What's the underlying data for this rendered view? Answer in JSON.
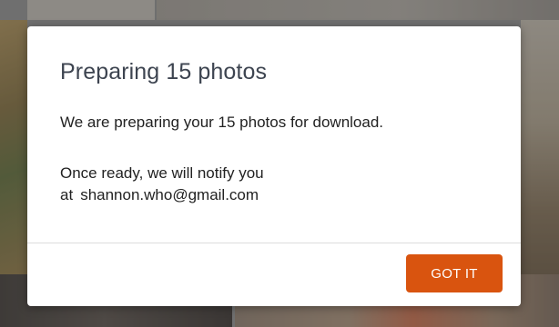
{
  "dialog": {
    "title": "Preparing 15 photos",
    "message": "We are preparing your 15 photos for download.",
    "notify_line": "Once ready, we will notify you",
    "notify_prefix": "at",
    "email": "shannon.who@gmail.com",
    "confirm_label": "GOT IT"
  },
  "colors": {
    "accent": "#d9540f",
    "title_text": "#3d4450",
    "body_text": "#222222"
  }
}
